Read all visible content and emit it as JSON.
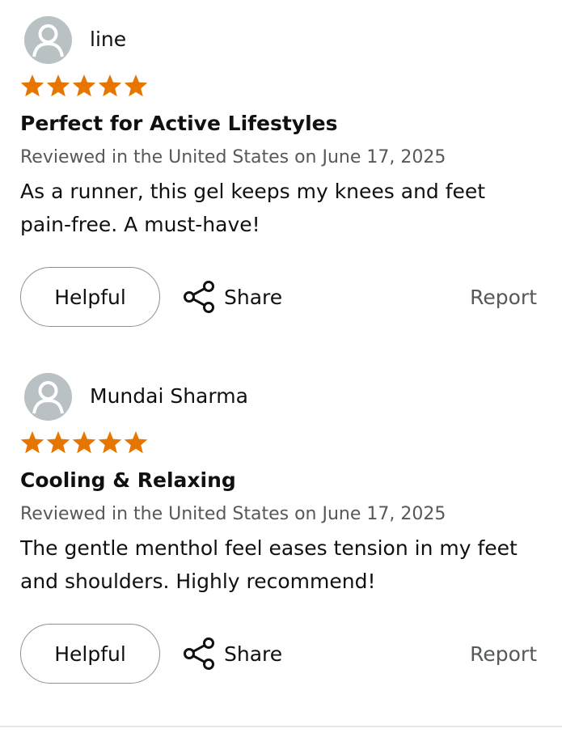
{
  "colors": {
    "star": "#e77600",
    "text": "#0f1111",
    "muted": "#565959",
    "avatar_bg": "#b9c1c5",
    "button_border": "#8d9096"
  },
  "icons": {
    "avatar": "user-silhouette-icon",
    "star": "star-icon",
    "share": "share-icon"
  },
  "reviews": [
    {
      "author": "line",
      "rating": 5,
      "title": "Perfect for Active Lifestyles",
      "meta": "Reviewed in the United States on June 17, 2025",
      "body": "As a runner, this gel keeps my knees and feet pain-free. A must-have!",
      "helpful_label": "Helpful",
      "share_label": "Share",
      "report_label": "Report"
    },
    {
      "author": "Mundai Sharma",
      "rating": 5,
      "title": "Cooling & Relaxing",
      "meta": "Reviewed in the United States on June 17, 2025",
      "body": "The gentle menthol feel eases tension in my feet and shoulders. Highly recommend!",
      "helpful_label": "Helpful",
      "share_label": "Share",
      "report_label": "Report"
    }
  ]
}
